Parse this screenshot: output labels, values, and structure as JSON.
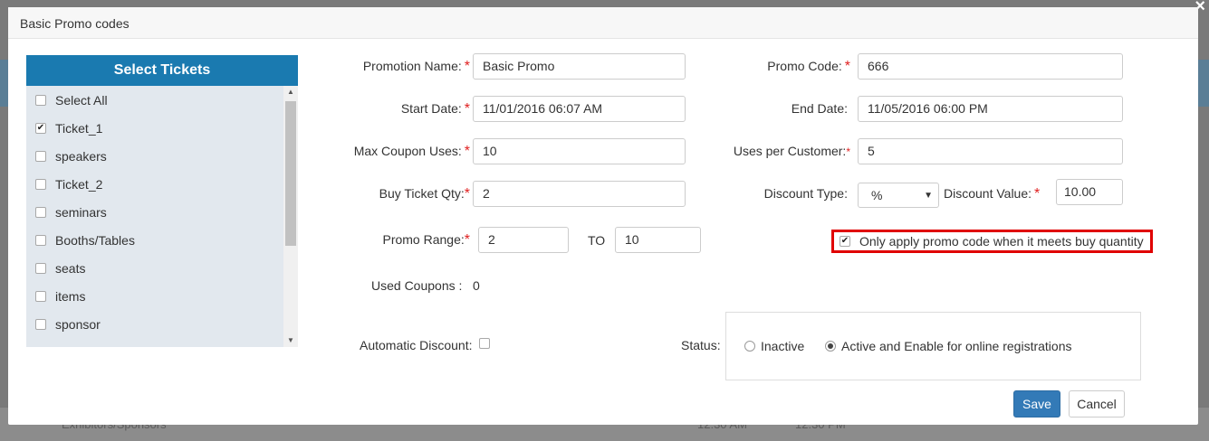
{
  "modal": {
    "title": "Basic Promo codes"
  },
  "tickets": {
    "header": "Select Tickets",
    "items": [
      {
        "label": "Select All",
        "checked": false
      },
      {
        "label": "Ticket_1",
        "checked": true
      },
      {
        "label": "speakers",
        "checked": false
      },
      {
        "label": "Ticket_2",
        "checked": false
      },
      {
        "label": "seminars",
        "checked": false
      },
      {
        "label": "Booths/Tables",
        "checked": false
      },
      {
        "label": "seats",
        "checked": false
      },
      {
        "label": "items",
        "checked": false
      },
      {
        "label": "sponsor",
        "checked": false
      }
    ]
  },
  "form": {
    "promotion_name_label": "Promotion Name:",
    "promotion_name_value": "Basic Promo",
    "promo_code_label": "Promo Code:",
    "promo_code_value": "666",
    "start_date_label": "Start Date:",
    "start_date_value": "11/01/2016 06:07 AM",
    "end_date_label": "End Date:",
    "end_date_value": "11/05/2016 06:00 PM",
    "max_coupon_uses_label": "Max Coupon Uses:",
    "max_coupon_uses_value": "10",
    "uses_per_customer_label": "Uses per Customer:",
    "uses_per_customer_value": "5",
    "buy_ticket_qty_label": "Buy Ticket Qty:",
    "buy_ticket_qty_value": "2",
    "discount_type_label": "Discount Type:",
    "discount_type_value": "%",
    "discount_value_label": "Discount Value:",
    "discount_value_value": "10.00",
    "promo_range_label": "Promo Range:",
    "promo_range_from": "2",
    "promo_range_to_label": "TO",
    "promo_range_to": "10",
    "only_apply_label": "Only apply promo code when it meets buy quantity",
    "only_apply_checked": true,
    "used_coupons_label": "Used Coupons :",
    "used_coupons_value": "0",
    "automatic_discount_label": "Automatic Discount:",
    "automatic_discount_checked": false,
    "status_label": "Status:",
    "status_inactive": "Inactive",
    "status_active": "Active and Enable for online registrations",
    "status_selected": "active"
  },
  "buttons": {
    "save": "Save",
    "cancel": "Cancel"
  },
  "background": {
    "row_text": "Exhibitors/Sponsors",
    "time1": "12:30 AM",
    "time2": "12:30 PM"
  },
  "colors": {
    "primary": "#337ab7",
    "ticket_header": "#1a7ab0",
    "required": "#e02020",
    "highlight": "#e00000"
  }
}
